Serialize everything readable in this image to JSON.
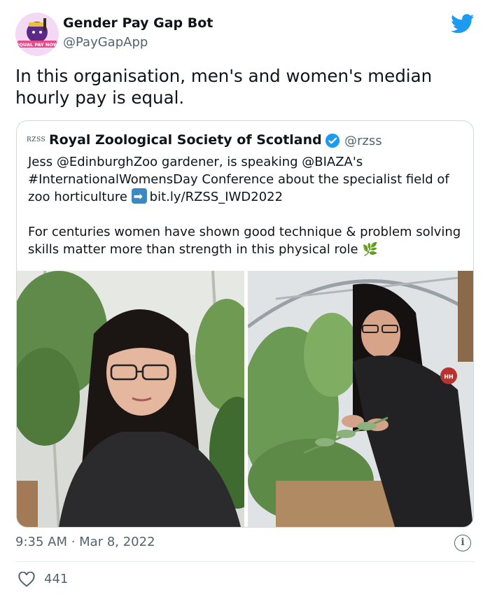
{
  "author": {
    "name": "Gender Pay Gap Bot",
    "handle": "@PayGapApp",
    "avatar_caption": "EQUAL PAY NOW"
  },
  "tweet": {
    "text": "In this organisation, men's and women's median hourly pay is equal."
  },
  "quoted": {
    "logo_text": "RZSS",
    "name": "Royal Zoological Society of Scotland",
    "handle": "@rzss",
    "verified": true,
    "line1": "Jess @EdinburghZoo gardener, is speaking @BIAZA's #InternationalWomensDay Conference about the specialist field of zoo horticulture",
    "link": "bit.ly/RZSS_IWD2022",
    "line2": "For centuries women have shown good technique & problem solving skills matter more than strength in this physical role",
    "photos": [
      "photo-portrait",
      "photo-gardening"
    ]
  },
  "meta": {
    "timestamp": "9:35 AM · Mar 8, 2022",
    "likes": "441"
  },
  "colors": {
    "twitter_blue": "#1d9bf0",
    "text_primary": "#0f1419",
    "text_secondary": "#536471",
    "border": "#cfd9de"
  },
  "icons": {
    "brand": "twitter-bird-icon",
    "verified": "verified-badge-icon",
    "info": "info-icon",
    "like": "heart-icon"
  }
}
